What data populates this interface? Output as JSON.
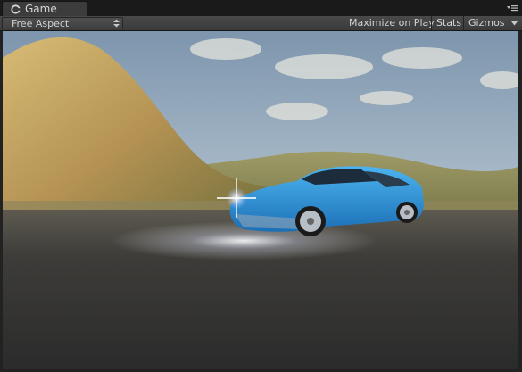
{
  "tab": {
    "label": "Game",
    "icon": "unity-logo-icon"
  },
  "toolbar": {
    "aspect_value": "Free Aspect",
    "maximize_label": "Maximize on Play",
    "stats_label": "Stats",
    "gizmos_label": "Gizmos",
    "gizmos_icon": "dropdown-arrow-icon"
  },
  "window_menu_icon": "panel-menu-icon",
  "scene": {
    "description_icons": [
      "sky",
      "hill",
      "terrain",
      "road",
      "car"
    ],
    "car_color": "#2a8fd8",
    "sky_color": "#a9bccb",
    "hill_color": "#c2a35e",
    "road_color": "#3a3a3a"
  }
}
